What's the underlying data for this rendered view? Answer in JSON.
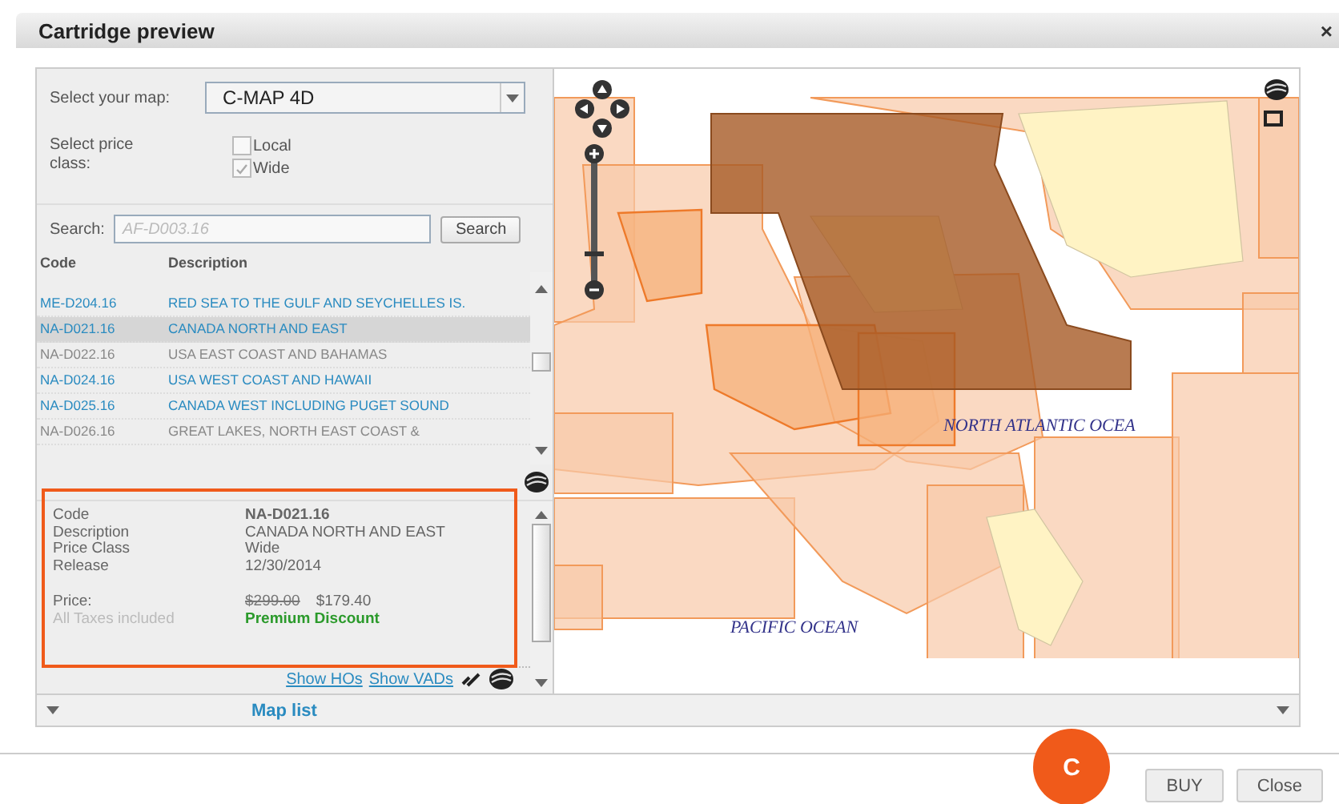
{
  "dialog": {
    "title": "Cartridge preview",
    "close": "×"
  },
  "map_select": {
    "label": "Select your map:",
    "value": "C-MAP 4D"
  },
  "price_class": {
    "label": "Select price class:",
    "options": [
      {
        "label": "Local",
        "checked": false
      },
      {
        "label": "Wide",
        "checked": true
      }
    ]
  },
  "search": {
    "label": "Search:",
    "placeholder": "AF-D003.16",
    "button": "Search"
  },
  "table": {
    "columns": [
      "Code",
      "Description"
    ],
    "rows": [
      {
        "code": "ME-D204.16",
        "description": "RED SEA TO THE GULF AND SEYCHELLES IS.",
        "available": true,
        "selected": false
      },
      {
        "code": "NA-D021.16",
        "description": "CANADA NORTH AND EAST",
        "available": true,
        "selected": true
      },
      {
        "code": "NA-D022.16",
        "description": "USA EAST COAST AND BAHAMAS",
        "available": false,
        "selected": false
      },
      {
        "code": "NA-D024.16",
        "description": "USA WEST COAST AND HAWAII",
        "available": true,
        "selected": false
      },
      {
        "code": "NA-D025.16",
        "description": "CANADA WEST INCLUDING PUGET SOUND",
        "available": true,
        "selected": false
      },
      {
        "code": "NA-D026.16",
        "description": "GREAT LAKES, NORTH EAST COAST &",
        "available": false,
        "selected": false
      }
    ]
  },
  "details": {
    "fields": [
      {
        "label": "Code",
        "value": "NA-D021.16",
        "strong": true
      },
      {
        "label": "Description",
        "value": "CANADA NORTH AND EAST",
        "strong": false
      },
      {
        "label": "Price Class",
        "value": "Wide",
        "strong": false
      },
      {
        "label": "Release",
        "value": "12/30/2014",
        "strong": false
      }
    ],
    "price_label": "Price:",
    "old_price": "$299.00",
    "new_price": "$179.40",
    "taxes": "All Taxes included",
    "discount": "Premium Discount",
    "links": [
      "Show HOs",
      "Show VADs"
    ]
  },
  "map": {
    "labels": [
      "NORTH ATLANTIC OCEA",
      "PACIFIC OCEAN"
    ],
    "footer": "Map list"
  },
  "annotation": {
    "badge": "C"
  },
  "buttons": [
    "BUY",
    "Close"
  ]
}
